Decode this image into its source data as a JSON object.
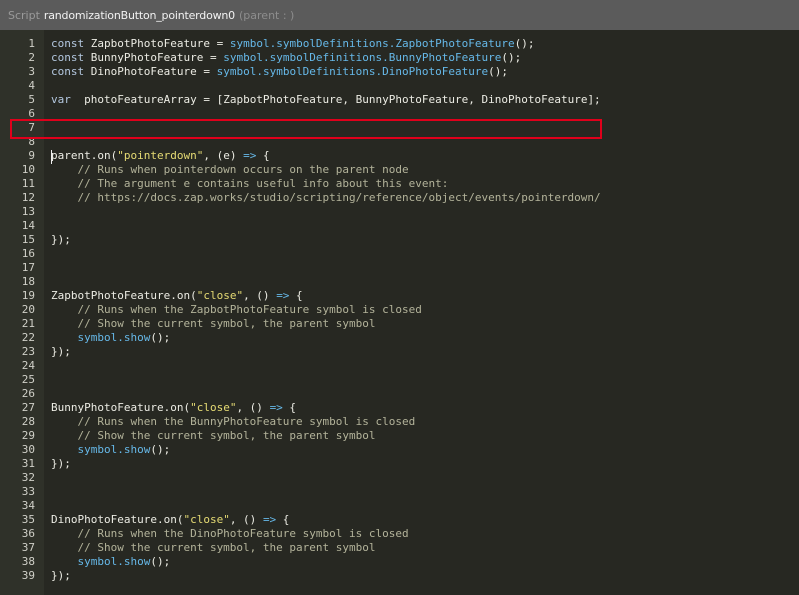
{
  "titlebar": {
    "prefix": "Script",
    "script_name": "randomizationButton_pointerdown0",
    "parent_label": "(parent : )"
  },
  "editor": {
    "lines": [
      {
        "num": "1",
        "tokens": [
          {
            "t": "kw",
            "v": "const "
          },
          {
            "t": "pl",
            "v": "ZapbotPhotoFeature "
          },
          {
            "t": "pl",
            "v": "= "
          },
          {
            "t": "sym",
            "v": "symbol.symbolDefinitions.ZapbotPhotoFeature"
          },
          {
            "t": "pl",
            "v": "();"
          }
        ]
      },
      {
        "num": "2",
        "tokens": [
          {
            "t": "kw",
            "v": "const "
          },
          {
            "t": "pl",
            "v": "BunnyPhotoFeature "
          },
          {
            "t": "pl",
            "v": "= "
          },
          {
            "t": "sym",
            "v": "symbol.symbolDefinitions.BunnyPhotoFeature"
          },
          {
            "t": "pl",
            "v": "();"
          }
        ]
      },
      {
        "num": "3",
        "tokens": [
          {
            "t": "kw",
            "v": "const "
          },
          {
            "t": "pl",
            "v": "DinoPhotoFeature "
          },
          {
            "t": "pl",
            "v": "= "
          },
          {
            "t": "sym",
            "v": "symbol.symbolDefinitions.DinoPhotoFeature"
          },
          {
            "t": "pl",
            "v": "();"
          }
        ]
      },
      {
        "num": "4",
        "tokens": []
      },
      {
        "num": "5",
        "tokens": [
          {
            "t": "kw",
            "v": "var  "
          },
          {
            "t": "pl",
            "v": "photoFeatureArray = [ZapbotPhotoFeature, BunnyPhotoFeature, DinoPhotoFeature];"
          }
        ]
      },
      {
        "num": "6",
        "tokens": []
      },
      {
        "num": "7",
        "tokens": []
      },
      {
        "num": "8",
        "tokens": []
      },
      {
        "num": "9",
        "tokens": [
          {
            "t": "pl",
            "v": "parent.on("
          },
          {
            "t": "str",
            "v": "\"pointerdown\""
          },
          {
            "t": "pl",
            "v": ", (e) "
          },
          {
            "t": "sym",
            "v": "=>"
          },
          {
            "t": "pl",
            "v": " {"
          }
        ]
      },
      {
        "num": "10",
        "tokens": [
          {
            "t": "cm",
            "v": "    // Runs when pointerdown occurs on the parent node"
          }
        ]
      },
      {
        "num": "11",
        "tokens": [
          {
            "t": "cm",
            "v": "    // The argument e contains useful info about this event:"
          }
        ]
      },
      {
        "num": "12",
        "tokens": [
          {
            "t": "cm",
            "v": "    // https://docs.zap.works/studio/scripting/reference/object/events/pointerdown/"
          }
        ]
      },
      {
        "num": "13",
        "tokens": []
      },
      {
        "num": "14",
        "tokens": []
      },
      {
        "num": "15",
        "tokens": [
          {
            "t": "pl",
            "v": "});"
          }
        ]
      },
      {
        "num": "16",
        "tokens": []
      },
      {
        "num": "17",
        "tokens": []
      },
      {
        "num": "18",
        "tokens": []
      },
      {
        "num": "19",
        "tokens": [
          {
            "t": "pl",
            "v": "ZapbotPhotoFeature.on("
          },
          {
            "t": "str",
            "v": "\"close\""
          },
          {
            "t": "pl",
            "v": ", () "
          },
          {
            "t": "sym",
            "v": "=>"
          },
          {
            "t": "pl",
            "v": " {"
          }
        ]
      },
      {
        "num": "20",
        "tokens": [
          {
            "t": "cm",
            "v": "    // Runs when the ZapbotPhotoFeature symbol is closed"
          }
        ]
      },
      {
        "num": "21",
        "tokens": [
          {
            "t": "cm",
            "v": "    // Show the current symbol, the parent symbol"
          }
        ]
      },
      {
        "num": "22",
        "tokens": [
          {
            "t": "pl",
            "v": "    "
          },
          {
            "t": "sym",
            "v": "symbol.show"
          },
          {
            "t": "pl",
            "v": "();"
          }
        ]
      },
      {
        "num": "23",
        "tokens": [
          {
            "t": "pl",
            "v": "});"
          }
        ]
      },
      {
        "num": "24",
        "tokens": []
      },
      {
        "num": "25",
        "tokens": []
      },
      {
        "num": "26",
        "tokens": []
      },
      {
        "num": "27",
        "tokens": [
          {
            "t": "pl",
            "v": "BunnyPhotoFeature.on("
          },
          {
            "t": "str",
            "v": "\"close\""
          },
          {
            "t": "pl",
            "v": ", () "
          },
          {
            "t": "sym",
            "v": "=>"
          },
          {
            "t": "pl",
            "v": " {"
          }
        ]
      },
      {
        "num": "28",
        "tokens": [
          {
            "t": "cm",
            "v": "    // Runs when the BunnyPhotoFeature symbol is closed"
          }
        ]
      },
      {
        "num": "29",
        "tokens": [
          {
            "t": "cm",
            "v": "    // Show the current symbol, the parent symbol"
          }
        ]
      },
      {
        "num": "30",
        "tokens": [
          {
            "t": "pl",
            "v": "    "
          },
          {
            "t": "sym",
            "v": "symbol.show"
          },
          {
            "t": "pl",
            "v": "();"
          }
        ]
      },
      {
        "num": "31",
        "tokens": [
          {
            "t": "pl",
            "v": "});"
          }
        ]
      },
      {
        "num": "32",
        "tokens": []
      },
      {
        "num": "33",
        "tokens": []
      },
      {
        "num": "34",
        "tokens": []
      },
      {
        "num": "35",
        "tokens": [
          {
            "t": "pl",
            "v": "DinoPhotoFeature.on("
          },
          {
            "t": "str",
            "v": "\"close\""
          },
          {
            "t": "pl",
            "v": ", () "
          },
          {
            "t": "sym",
            "v": "=>"
          },
          {
            "t": "pl",
            "v": " {"
          }
        ]
      },
      {
        "num": "36",
        "tokens": [
          {
            "t": "cm",
            "v": "    // Runs when the DinoPhotoFeature symbol is closed"
          }
        ]
      },
      {
        "num": "37",
        "tokens": [
          {
            "t": "cm",
            "v": "    // Show the current symbol, the parent symbol"
          }
        ]
      },
      {
        "num": "38",
        "tokens": [
          {
            "t": "pl",
            "v": "    "
          },
          {
            "t": "sym",
            "v": "symbol.show"
          },
          {
            "t": "pl",
            "v": "();"
          }
        ]
      },
      {
        "num": "39",
        "tokens": [
          {
            "t": "pl",
            "v": "});"
          }
        ]
      }
    ],
    "highlighted_line": "5",
    "cursor_line": "7"
  },
  "colors": {
    "editor_bg": "#272822",
    "gutter_bg": "#2f3129",
    "titlebar_bg": "#5b5b5b",
    "highlight_border": "#e0001b"
  }
}
